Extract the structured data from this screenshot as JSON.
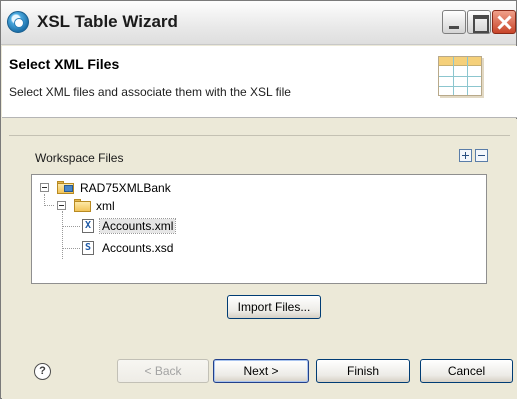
{
  "window": {
    "title": "XSL Table Wizard"
  },
  "header": {
    "title": "Select XML Files",
    "description": "Select XML files and associate them with the XSL file"
  },
  "workspace": {
    "label": "Workspace Files"
  },
  "tree": {
    "project": "RAD75XMLBank",
    "folder": "xml",
    "files": [
      {
        "name": "Accounts.xml",
        "type_glyph": "X",
        "selected": true
      },
      {
        "name": "Accounts.xsd",
        "type_glyph": "S",
        "selected": false
      }
    ]
  },
  "buttons": {
    "import": "Import Files...",
    "back": "< Back",
    "next": "Next >",
    "finish": "Finish",
    "cancel": "Cancel",
    "help": "?"
  },
  "colors": {
    "dialog_background": "#ece9d8",
    "selection_highlight": "#e6e6e6",
    "button_border": "#003c74"
  }
}
